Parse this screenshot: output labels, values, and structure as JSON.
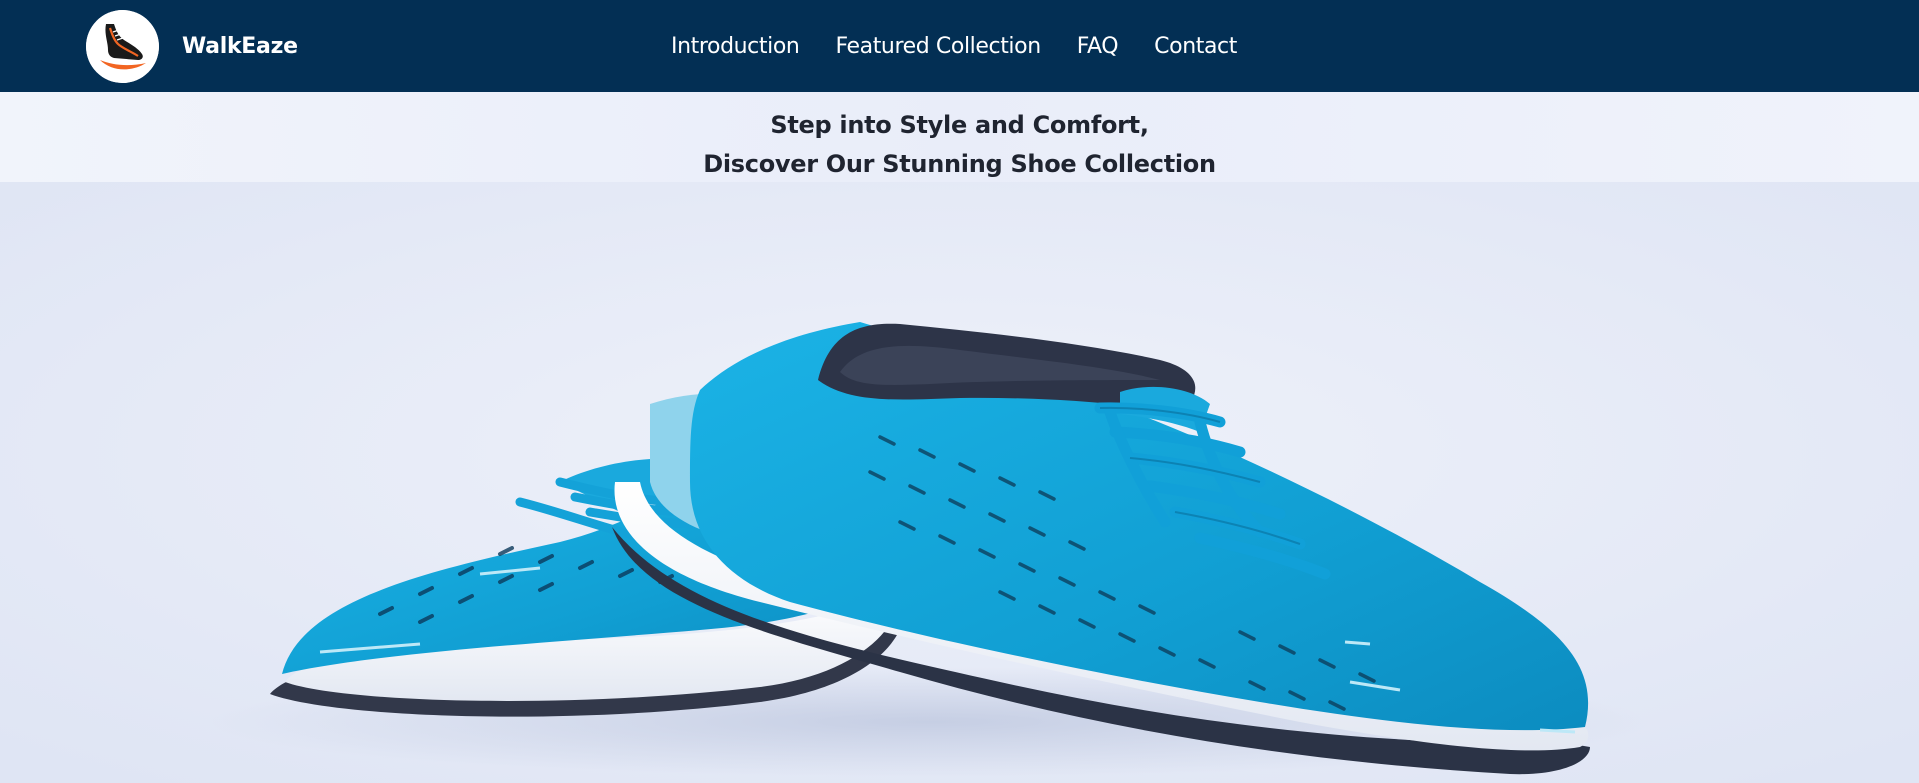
{
  "header": {
    "brand": "WalkEaze",
    "logo_icon": "running-shoe-logo-icon",
    "nav": [
      {
        "label": "Introduction"
      },
      {
        "label": "Featured Collection"
      },
      {
        "label": "FAQ"
      },
      {
        "label": "Contact"
      }
    ]
  },
  "hero": {
    "title_line1": "Step into Style and Comfort,",
    "title_line2": "Discover Our Stunning Shoe Collection",
    "image_icon": "blue-running-shoes-image"
  },
  "colors": {
    "navbar": "#032f54",
    "hero_bg": "#e8ecf8",
    "shoe_blue": "#13a3d6",
    "logo_accent": "#f26522"
  }
}
